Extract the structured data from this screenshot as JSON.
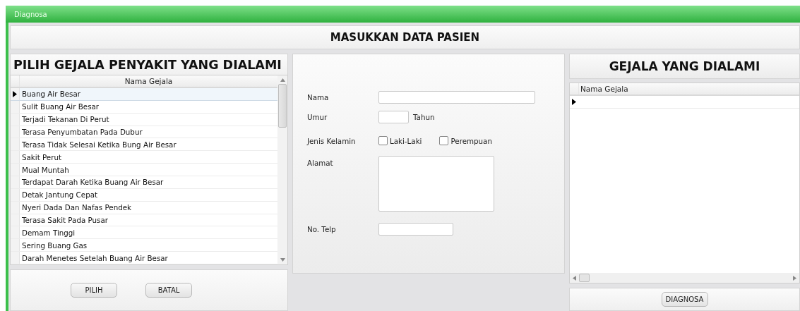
{
  "window": {
    "title": "Diagnosa"
  },
  "header": {
    "title": "MASUKKAN DATA PASIEN"
  },
  "symptom_picker": {
    "title": "PILIH GEJALA PENYAKIT YANG DIALAMI",
    "column": "Nama Gejala",
    "rows": [
      {
        "label": "Buang Air Besar",
        "selected": true
      },
      {
        "label": "Sulit Buang Air Besar",
        "selected": false
      },
      {
        "label": "Terjadi Tekanan Di Perut",
        "selected": false
      },
      {
        "label": "Terasa Penyumbatan Pada Dubur",
        "selected": false
      },
      {
        "label": "Terasa Tidak Selesai Ketika Bung Air Besar",
        "selected": false
      },
      {
        "label": "Sakit Perut",
        "selected": false
      },
      {
        "label": "Mual Muntah",
        "selected": false
      },
      {
        "label": "Terdapat Darah Ketika Buang Air Besar",
        "selected": false
      },
      {
        "label": "Detak Jantung Cepat",
        "selected": false
      },
      {
        "label": "Nyeri Dada Dan Nafas Pendek",
        "selected": false
      },
      {
        "label": "Terasa Sakit Pada Pusar",
        "selected": false
      },
      {
        "label": "Demam Tinggi",
        "selected": false
      },
      {
        "label": "Sering Buang Gas",
        "selected": false
      },
      {
        "label": "Darah Menetes Setelah Buang Air Besar",
        "selected": false
      }
    ],
    "buttons": [
      "PILIH",
      "BATAL"
    ]
  },
  "patient_form": {
    "name_label": "Nama",
    "age_label": "Umur",
    "age_unit": "Tahun",
    "gender_label": "Jenis Kelamin",
    "genders": [
      {
        "label": "Laki-Laki",
        "checked": false
      },
      {
        "label": "Perempuan",
        "checked": false
      }
    ],
    "address_label": "Alamat",
    "phone_label": "No. Telp"
  },
  "chosen_symptoms": {
    "title": "GEJALA YANG DIALAMI",
    "column": "Nama Gejala",
    "button": "DIAGNOSA"
  }
}
